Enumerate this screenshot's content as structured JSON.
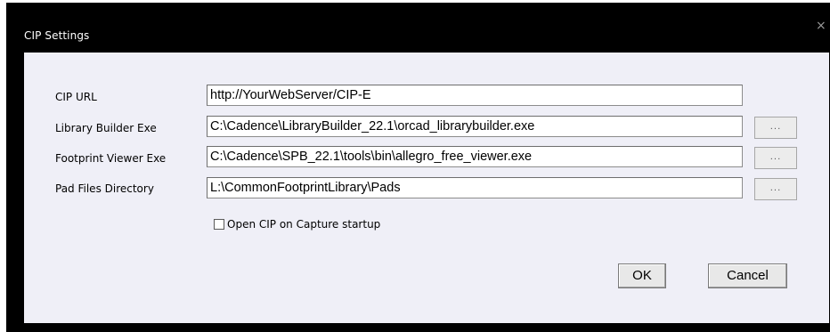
{
  "dialog": {
    "title": "CIP Settings",
    "close_label": "×"
  },
  "fields": [
    {
      "label": "CIP URL",
      "value": "http://YourWebServer/CIP-E"
    },
    {
      "label": "Library Builder Exe",
      "value": "C:\\Cadence\\LibraryBuilder_22.1\\orcad_librarybuilder.exe",
      "browse_label": "..."
    },
    {
      "label": "Footprint Viewer Exe",
      "value": "C:\\Cadence\\SPB_22.1\\tools\\bin\\allegro_free_viewer.exe",
      "browse_label": "..."
    },
    {
      "label": "Pad Files Directory",
      "value": "L:\\CommonFootprintLibrary\\Pads",
      "browse_label": "..."
    }
  ],
  "checkbox": {
    "label": "Open CIP on Capture startup",
    "checked": false
  },
  "buttons": {
    "ok": "OK",
    "cancel": "Cancel"
  },
  "colors": {
    "title_bar": "#000000",
    "content_background": "#efeff7"
  }
}
